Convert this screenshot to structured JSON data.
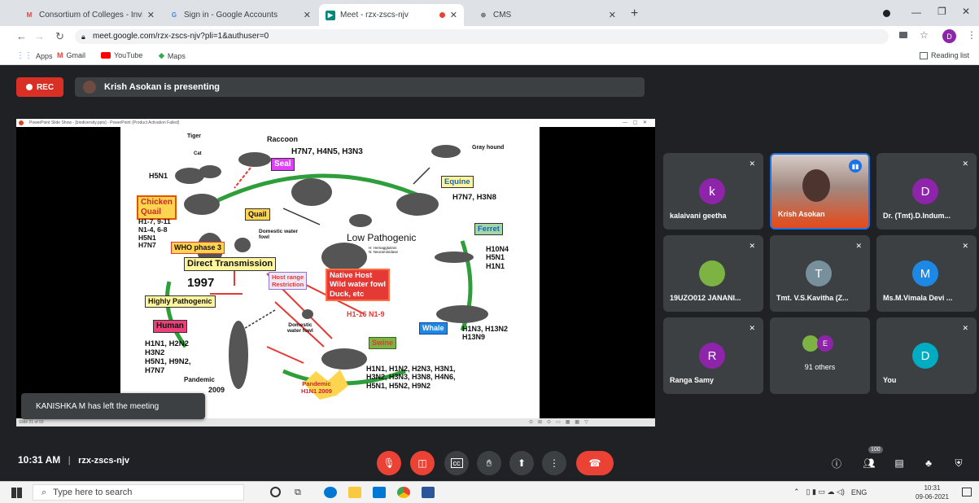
{
  "browser": {
    "tabs": [
      {
        "title": "Consortium of Colleges - Invitati",
        "icon": "gmail-icon",
        "color": "#ea4335"
      },
      {
        "title": "Sign in - Google Accounts",
        "icon": "google-icon",
        "color": "#4285f4"
      },
      {
        "title": "Meet - rzx-zscs-njv",
        "icon": "meet-icon",
        "color": "#00897b"
      },
      {
        "title": "CMS",
        "icon": "globe-icon",
        "color": "#5f6368"
      }
    ],
    "url": "meet.google.com/rzx-zscs-njv?pli=1&authuser=0",
    "profile_initial": "D",
    "bookmarks": [
      "Apps",
      "Gmail",
      "YouTube",
      "Maps"
    ],
    "reading_list": "Reading list"
  },
  "meet": {
    "rec_label": "REC",
    "presenting_text": "Krish Asokan is presenting",
    "toast": "KANISHKA M has left the meeting",
    "time": "10:31 AM",
    "separator": "|",
    "meeting_code": "rzx-zscs-njv",
    "participant_badge": "100",
    "accent": "#1a73e8",
    "danger": "#ea4335"
  },
  "slide": {
    "window_title": "PowerPoint Slide Show - [biodiversity.pptx] - PowerPoint (Product Activation Failed)",
    "status": "Slide 21 of 93",
    "tiger": "Tiger",
    "cat": "Cat",
    "raccoon": "Raccoon",
    "top_strains": "H7N7, H4N5, H3N3",
    "seal": "Seal",
    "gray_hound": "Gray hound",
    "h5n1_top": "H5N1",
    "chicken_quail": "Chicken\nQuail",
    "chicken_strains": "H1-7, 9-11\nN1-4, 6-8\nH5N1\nH7N7",
    "quail": "Quail",
    "who_phase": "WHO phase 3",
    "equine": "Equine",
    "equine_strains": "H7N7, H3N8",
    "domestic_water_fowl": "Domestic water\nfowl",
    "low_pathogenic": "Low Pathogenic",
    "h_note": "H: Hemagglutinin\nN: Neuraminidase",
    "ferret": "Ferret",
    "ferret_strains": "H10N4\nH5N1\nH1N1",
    "direct_transmission": "Direct Transmission",
    "year": "1997",
    "host_range": "Host range\nRestriction",
    "native_host": "Native Host\nWild water fowl\nDuck, etc",
    "h1_16": "H1-16 N1-9",
    "highly_pathogenic": "Highly Pathogenic",
    "human": "Human",
    "human_strains": "H1N1, H2N2\nH3N2\nH5N1, H9N2,\nH7N7",
    "pandemic_human": "Pandemic",
    "year_2009": "2009",
    "domestic_water_fowl2": "Domestic\nwater fowl",
    "whale": "Whale",
    "whale_strains": "H1N3, H13N2\nH13N9",
    "swine": "Swine",
    "swine_strains": "H1N1, H1N2, H2N3, H3N1,\nH3N2, H3N3, H3N8, H4N6,\nH5N1, H5N2, H9N2",
    "pandemic_h1n1": "Pandemic\nH1N1 2009"
  },
  "participants": [
    {
      "name": "kalaivani geetha",
      "initial": "k",
      "color": "#8e24aa",
      "type": "avatar"
    },
    {
      "name": "Krish Asokan",
      "initial": "",
      "color": "#6d4c41",
      "type": "video"
    },
    {
      "name": "Dr. (Tmt).D.Indum...",
      "initial": "D",
      "color": "#8e24aa",
      "type": "avatar"
    },
    {
      "name": "19UZO012 JANANI...",
      "initial": "",
      "color": "#7cb342",
      "type": "photo"
    },
    {
      "name": "Tmt. V.S.Kavitha (Z...",
      "initial": "T",
      "color": "#78909c",
      "type": "avatar"
    },
    {
      "name": "Ms.M.Vimala Devi ...",
      "initial": "M",
      "color": "#1e88e5",
      "type": "avatar"
    },
    {
      "name": "Ranga Samy",
      "initial": "R",
      "color": "#8e24aa",
      "type": "avatar"
    },
    {
      "name": "91 others",
      "initial": "E",
      "color": "#8e24aa",
      "type": "others"
    },
    {
      "name": "You",
      "initial": "D",
      "color": "#00acc1",
      "type": "avatar"
    }
  ],
  "taskbar": {
    "search_placeholder": "Type here to search",
    "lang": "ENG",
    "time": "10:31",
    "date": "09-06-2021"
  }
}
